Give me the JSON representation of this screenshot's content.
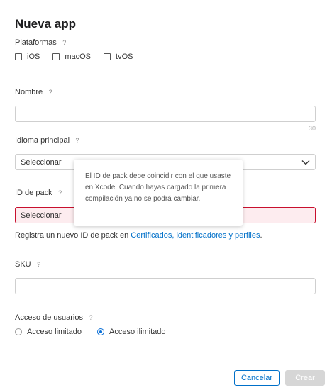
{
  "page": {
    "title": "Nueva app"
  },
  "platforms": {
    "label": "Plataformas",
    "help": "?",
    "options": [
      {
        "label": "iOS",
        "checked": false
      },
      {
        "label": "macOS",
        "checked": false
      },
      {
        "label": "tvOS",
        "checked": false
      }
    ]
  },
  "name": {
    "label": "Nombre",
    "help": "?",
    "value": "",
    "counter": "30"
  },
  "language": {
    "label": "Idioma principal",
    "help": "?",
    "value": "Seleccionar"
  },
  "bundle_id": {
    "label": "ID de pack",
    "help": "?",
    "value": "Seleccionar",
    "helper_prefix": "Registra un nuevo ID de pack en ",
    "helper_link": "Certificados, identificadores y perfiles",
    "helper_suffix": "."
  },
  "tooltip": {
    "text": "El ID de pack debe coincidir con el que usaste en Xcode. Cuando hayas cargado la primera compilación ya no se podrá cambiar."
  },
  "sku": {
    "label": "SKU",
    "help": "?",
    "value": ""
  },
  "user_access": {
    "label": "Acceso de usuarios",
    "help": "?",
    "options": [
      {
        "label": "Acceso limitado",
        "checked": false
      },
      {
        "label": "Acceso ilimitado",
        "checked": true
      }
    ]
  },
  "footer": {
    "cancel_label": "Cancelar",
    "create_label": "Crear"
  },
  "colors": {
    "accent": "#0070c9",
    "error_border": "#c8102e",
    "error_bg": "#fdecef",
    "disabled_button": "#d6d6d6"
  }
}
